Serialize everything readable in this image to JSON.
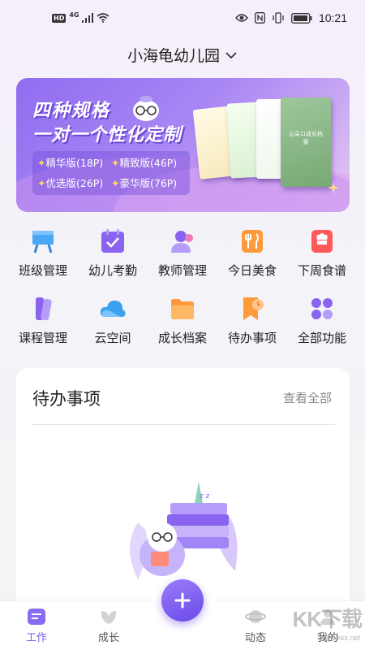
{
  "status_bar": {
    "hd": "HD",
    "network": "4G",
    "time": "10:21"
  },
  "header": {
    "school_name": "小海龟幼儿园"
  },
  "banner": {
    "title_line1": "四种规格",
    "title_line2": "一对一个性化定制",
    "plans": [
      "精华版(18P)",
      "精致版(46P)",
      "优选版(26P)",
      "豪华版(76P)"
    ],
    "book_label": "云朵ロ成长档案"
  },
  "menu": {
    "items": [
      {
        "label": "班级管理",
        "icon": "class-board-icon",
        "color": "#3aa0f0"
      },
      {
        "label": "幼儿考勤",
        "icon": "attendance-icon",
        "color": "#8a63f0"
      },
      {
        "label": "教师管理",
        "icon": "teacher-icon",
        "color": "#8a63f0"
      },
      {
        "label": "今日美食",
        "icon": "food-icon",
        "color": "#ff9a3c"
      },
      {
        "label": "下周食谱",
        "icon": "recipe-icon",
        "color": "#ff5a5a"
      },
      {
        "label": "课程管理",
        "icon": "course-icon",
        "color": "#8a63f0"
      },
      {
        "label": "云空间",
        "icon": "cloud-icon",
        "color": "#3aa0f0"
      },
      {
        "label": "成长档案",
        "icon": "folder-icon",
        "color": "#ff9a3c"
      },
      {
        "label": "待办事项",
        "icon": "todo-icon",
        "color": "#ff9a3c"
      },
      {
        "label": "全部功能",
        "icon": "all-apps-icon",
        "color": "#8a63f0"
      }
    ]
  },
  "todo_card": {
    "title": "待办事项",
    "more": "查看全部"
  },
  "bottom_nav": {
    "items": [
      {
        "label": "工作",
        "icon": "work-icon",
        "active": true
      },
      {
        "label": "成长",
        "icon": "leaf-icon",
        "active": false
      },
      {
        "label": "动态",
        "icon": "planet-icon",
        "active": false
      },
      {
        "label": "我的",
        "icon": "profile-icon",
        "active": false
      }
    ],
    "accent": "#7b5cf0"
  },
  "watermark": {
    "text": "KK下载",
    "url": "www.kkx.net"
  }
}
